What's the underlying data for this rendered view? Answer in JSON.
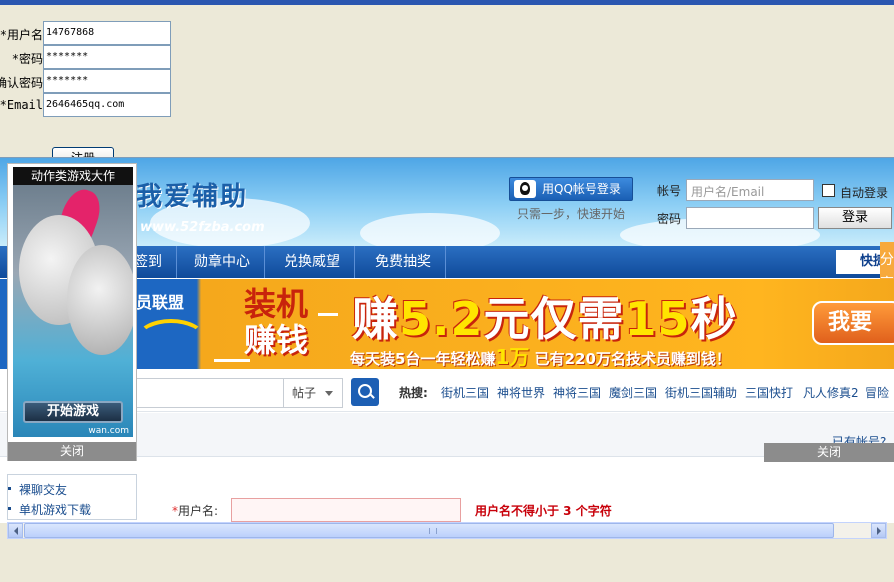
{
  "form": {
    "fields": [
      {
        "label": "*用户名",
        "value": "14767868"
      },
      {
        "label": "*密码",
        "value": "*******"
      },
      {
        "label": "确认密码",
        "value": "*******"
      },
      {
        "label": "*Email",
        "value": "2646465qq.com"
      }
    ],
    "submit_label": "注册"
  },
  "site": {
    "logo": "我爱辅助",
    "logo_url": "www.52fzba.com",
    "qq_login_label": "用QQ帐号登录",
    "qq_login_sub": "只需一步，快速开始",
    "account_label": "帐号",
    "account_placeholder": "用户名/Email",
    "password_label": "密码",
    "auto_login_label": "自动登录",
    "login_button": "登录",
    "nav": [
      "签到",
      "勋章中心",
      "兑换威望",
      "免费抽奖"
    ],
    "quick_nav": "快捷",
    "share_tab": "分享",
    "banner": {
      "left_text": "员联盟",
      "line1": "装机",
      "line2": "赚钱",
      "headline_pre": "赚",
      "headline_num1": "5.2",
      "headline_mid": "元仅需",
      "headline_num2": "15",
      "headline_post": "秒",
      "sub_pre": "每天装5台一年轻松赚",
      "sub_num": "1万",
      "sub_post": "已有220万名技术员赚到钱！",
      "cta": "我要"
    },
    "search": {
      "scope": "帖子",
      "hot_label": "热搜:",
      "hot_links": [
        "街机三国",
        "神将世界",
        "神将三国",
        "魔剑三国",
        "街机三国辅助",
        "三国快打",
        "凡人修真2",
        "冒险"
      ]
    },
    "has_account": "已有帐号?",
    "close_right": "关闭",
    "side_links": [
      "裸聊交友",
      "单机游戏下载"
    ],
    "username_label": "用户名:",
    "username_required": "*",
    "username_error": "用户名不得小于  3 个字符"
  },
  "ad": {
    "title": "动作类游戏大作",
    "play_label": "开始游戏",
    "url": "wan.com",
    "close_label": "关闭"
  },
  "colors": {
    "nav_blue": "#1d5fb4",
    "banner_orange": "#ffb51f",
    "error_red": "#c8000a"
  }
}
